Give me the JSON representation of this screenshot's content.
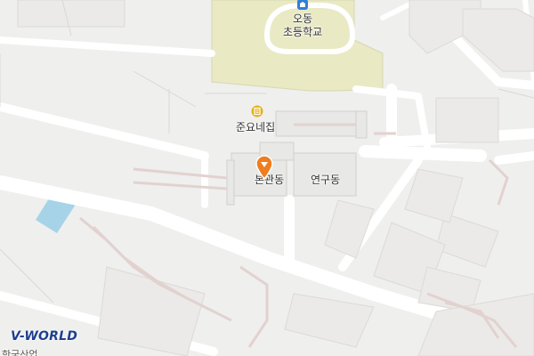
{
  "map": {
    "school_label": "오동\n초등학교",
    "poi_label": "준요네집",
    "main_building_label": "본관동",
    "research_building_label": "연구동",
    "bottom_edge_label": "한국산업",
    "brand": "V-WORLD",
    "colors": {
      "background": "#efefee",
      "road": "#ffffff",
      "school_zone": "#e9e9c4",
      "water": "#a6d3e8",
      "path": "#e2d2cf",
      "marker": "#f07d1e",
      "school_icon": "#2f7fd6",
      "poi_icon": "#e6b11a",
      "brand": "#1d3f8f"
    },
    "icons": [
      "school-icon",
      "restaurant-icon",
      "location-marker-icon"
    ]
  }
}
